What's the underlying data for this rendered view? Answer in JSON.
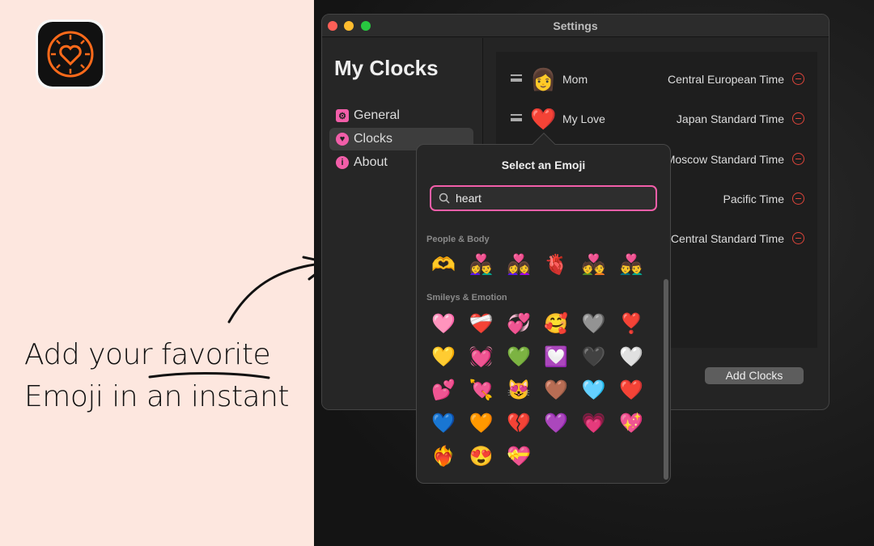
{
  "tagline": {
    "line1": "Add your favorite",
    "line2": "Emoji in an instant"
  },
  "window": {
    "title": "Settings"
  },
  "sidebar": {
    "title": "My Clocks",
    "items": [
      {
        "label": "General",
        "icon": "gear-icon"
      },
      {
        "label": "Clocks",
        "icon": "heart-icon",
        "selected": true
      },
      {
        "label": "About",
        "icon": "info-icon"
      }
    ]
  },
  "clocks": [
    {
      "emoji": "👩",
      "name": "Mom",
      "timezone": "Central European Time"
    },
    {
      "emoji": "❤️",
      "name": "My Love",
      "timezone": "Japan Standard Time"
    },
    {
      "emoji": "",
      "name": "",
      "timezone": "Moscow Standard Time"
    },
    {
      "emoji": "",
      "name": "",
      "timezone": "Pacific Time"
    },
    {
      "emoji": "",
      "name": "",
      "timezone": "Central Standard Time"
    }
  ],
  "add_button": "Add Clocks",
  "emoji_picker": {
    "title": "Select an Emoji",
    "search_value": "heart",
    "sections": [
      {
        "label": "People & Body",
        "emojis": [
          "🫶",
          "👩‍❤️‍👨",
          "👩‍❤️‍👩",
          "🫀",
          "💑",
          "👨‍❤️‍👨"
        ]
      },
      {
        "label": "Smileys & Emotion",
        "emojis": [
          "🩷",
          "❤️‍🩹",
          "💞",
          "🥰",
          "🩶",
          "❣️",
          "💛",
          "💓",
          "💚",
          "💟",
          "🖤",
          "🤍",
          "💕",
          "💘",
          "😻",
          "🤎",
          "🩵",
          "❤️",
          "💙",
          "🧡",
          "💔",
          "💜",
          "💗",
          "💖",
          "❤️‍🔥",
          "😍",
          "💝"
        ]
      }
    ]
  },
  "colors": {
    "accent": "#f25ea9",
    "remove": "#e0443a",
    "background": "#fde7df"
  }
}
